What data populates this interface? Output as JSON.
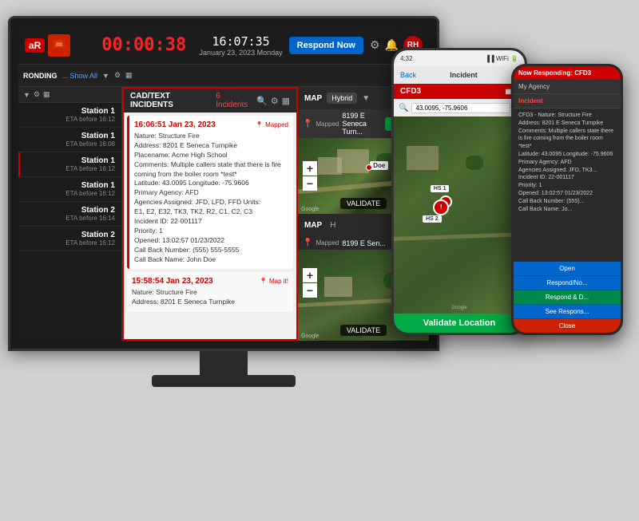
{
  "header": {
    "timer": "00:00:38",
    "time": "16:07:35",
    "date_day": "January 23, 2023",
    "day_of_week": "Monday",
    "respond_btn": "Respond Now",
    "user_initials": "RH"
  },
  "subheader": {
    "responding_label": "RONDING",
    "show_all": "... Show All"
  },
  "stations": [
    {
      "name": "Station 1",
      "eta": "ETA before 16:12",
      "active": false
    },
    {
      "name": "Station 1",
      "eta": "ETA before 16:08",
      "active": false
    },
    {
      "name": "Station 1",
      "eta": "ETA before 16:12",
      "active": true
    },
    {
      "name": "Station 1",
      "eta": "ETA before 16:12",
      "active": false
    },
    {
      "name": "Station 2",
      "eta": "ETA before 16:14",
      "active": false
    },
    {
      "name": "Station 2",
      "eta": "ETA before 16:12",
      "active": false
    }
  ],
  "incidents_panel": {
    "title": "CAD/TEXT INCIDENTS",
    "count_label": "6 Incidents"
  },
  "incident1": {
    "time": "16:06:51 Jan 23, 2023",
    "status": "📍 Mapped",
    "nature": "Nature: Structure Fire",
    "address": "Address: 8201 E Seneca Turnpike",
    "placename": "Placename: Acme High School",
    "comments": "Comments: Multiple callers state that there is fire coming from the boiler room *test*",
    "latitude": "Latitude: 43.0095 Longitude: -75.9606",
    "primary_agency": "Primary Agency: AFD",
    "agencies": "Agencies Assigned: JFD, LFD, FFD Units:",
    "units": "E1, E2, E32, TK3, TK2, R2, C1, C2, C3",
    "incident_id": "Incident ID: 22-001117",
    "priority": "Priority: 1",
    "opened": "Opened: 13:02:57 01/23/2022",
    "callback": "Call Back Number: (555) 555-5555",
    "callback_name": "Call Back Name: John Doe"
  },
  "incident2": {
    "time": "15:58:54 Jan 23, 2023",
    "status": "📍 Map it!",
    "nature": "Nature: Structure Fire",
    "address": "Address: 8201 E Seneca Turnpike"
  },
  "map_panel": {
    "title": "MAP",
    "hybrid_label": "Hybrid",
    "address": "8199 E Seneca Turn...",
    "go_btn": "GO!",
    "validate_label": "VALIDATE",
    "google_label": "Google"
  },
  "phone_main": {
    "time": "4:32",
    "back": "Back",
    "incident_title": "Incident",
    "incident_id": "CFD3",
    "search_coords": "43.0095, -75.9606",
    "validate_btn": "Validate Location"
  },
  "phone_small": {
    "header": "Now Responding: CFD3",
    "my_agency": "My Agency",
    "incident_title": "Incident",
    "incident_id": "CFD3",
    "incident_details": "CFD3 - Nature: Structure Fire\nAddress: 8201 E Seneca Turnpike\nComments: Multiple callers state there is fire coming from the boiler room *test*\nLatitude: 43.0095 Longitude: -75.9606\nPrimary Agency: AFD\nAgencies Assigned: JFD, TK3...\nIncident ID: 22-001117\nPriority: 1\nOpened: 13:02:57 01/23/2022\nCall Back Number: (555)...\nCall Back Name: Jo...",
    "btn1": "Open",
    "btn2": "Respond/No...",
    "btn3": "Respond & D...",
    "btn4": "See Respons...",
    "btn5": "Close"
  }
}
